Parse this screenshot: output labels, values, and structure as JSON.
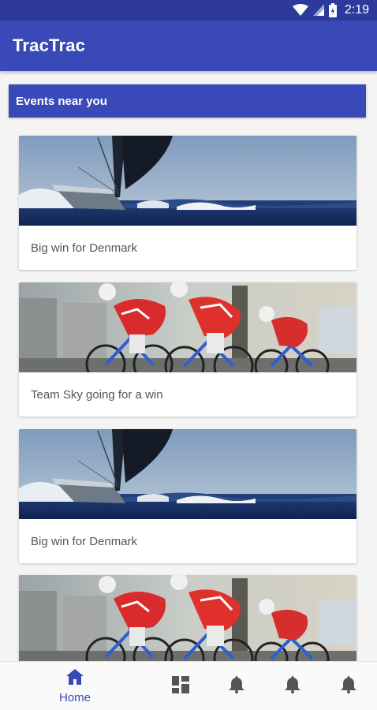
{
  "status_bar": {
    "time": "2:19",
    "icons": [
      "wifi-icon",
      "cell-signal-icon",
      "battery-icon"
    ]
  },
  "app_bar": {
    "title": "TracTrac"
  },
  "section": {
    "title": "Events near you"
  },
  "events": [
    {
      "caption": "Big win for Denmark",
      "image": "sailing-photo"
    },
    {
      "caption": "Team Sky going for a win",
      "image": "cycling-photo"
    },
    {
      "caption": "Big win for Denmark",
      "image": "sailing-photo"
    },
    {
      "caption": "",
      "image": "cycling-photo"
    }
  ],
  "bottom_nav": {
    "items": [
      {
        "label": "Home",
        "icon": "home-icon",
        "active": true
      },
      {
        "label": "",
        "icon": "dashboard-icon",
        "active": false
      },
      {
        "label": "",
        "icon": "bell-icon",
        "active": false
      },
      {
        "label": "",
        "icon": "bell-icon",
        "active": false
      },
      {
        "label": "",
        "icon": "bell-icon",
        "active": false
      }
    ]
  },
  "colors": {
    "primary": "#3949b8",
    "primary_dark": "#2d3a9c",
    "icon_inactive": "#555555",
    "background": "#f4f4f4"
  }
}
